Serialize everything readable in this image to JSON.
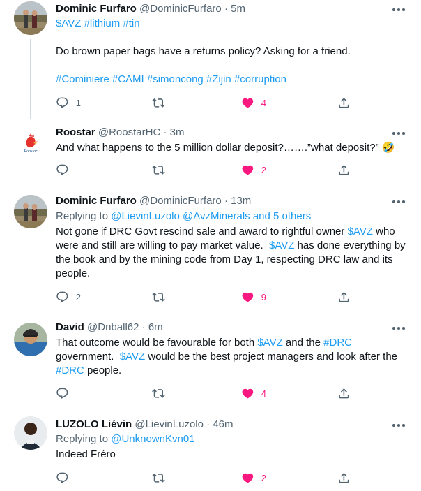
{
  "tweets": [
    {
      "name": "Dominic Furfaro",
      "handle": "@DominicFurfaro",
      "dot": "·",
      "time": "5m",
      "tags_line": "$AVZ #lithium #tin",
      "text": "Do brown paper bags have a returns policy? Asking for a friend.",
      "hashtags_line": "#Cominiere #CAMI #simoncong #Zijin #corruption",
      "replies": "1",
      "retweets": "",
      "likes": "4"
    },
    {
      "name": "Roostar",
      "handle": "@RoostarHC",
      "dot": "·",
      "time": "3m",
      "text": "And what happens to the 5 million dollar deposit?…….”what deposit?” 🤣",
      "replies": "",
      "retweets": "",
      "likes": "2"
    },
    {
      "name": "Dominic Furfaro",
      "handle": "@DominicFurfaro",
      "dot": "·",
      "time": "13m",
      "replying_prefix": "Replying to ",
      "replying_to": "@LievinLuzolo @AvzMinerals and 5 others",
      "text_l1a": "Not gone if DRC Govt rescind sale and award to rightful owner ",
      "text_l1b": "$AVZ",
      "text_l1c": " who",
      "text_l2a": "were and still are willing to pay market value.  ",
      "text_l2b": "$AVZ",
      "text_l2c": " has done everything by",
      "text_l3": "the book and by the mining code from Day 1, respecting DRC law and its",
      "text_l4": "people.",
      "replies": "2",
      "retweets": "",
      "likes": "9"
    },
    {
      "name": "David",
      "handle": "@Dnball62",
      "dot": "·",
      "time": "6m",
      "text_l1a": "That outcome would be favourable for both ",
      "text_l1b": "$AVZ",
      "text_l1c": " and the ",
      "text_l1d": "#DRC",
      "text_l2a": "government.  ",
      "text_l2b": "$AVZ",
      "text_l2c": " would be the best project managers and look after the",
      "text_l3a": "#DRC",
      "text_l3b": " people.",
      "replies": "",
      "retweets": "",
      "likes": "4"
    },
    {
      "name": "LUZOLO Liévin",
      "handle": "@LievinLuzolo",
      "dot": "·",
      "time": "46m",
      "replying_prefix": "Replying to ",
      "replying_to": "@UnknownKvn01",
      "text": "Indeed Fréro",
      "replies": "",
      "retweets": "",
      "likes": "2"
    }
  ],
  "icons": {
    "reply": "reply-icon",
    "retweet": "retweet-icon",
    "like": "heart-icon",
    "share": "share-icon",
    "more": "more-icon"
  },
  "colors": {
    "link": "#1d9bf0",
    "like": "#f91880",
    "muted": "#536471",
    "text": "#0f1419",
    "separator": "#eff3f4",
    "thread_line": "#cfd9de"
  }
}
